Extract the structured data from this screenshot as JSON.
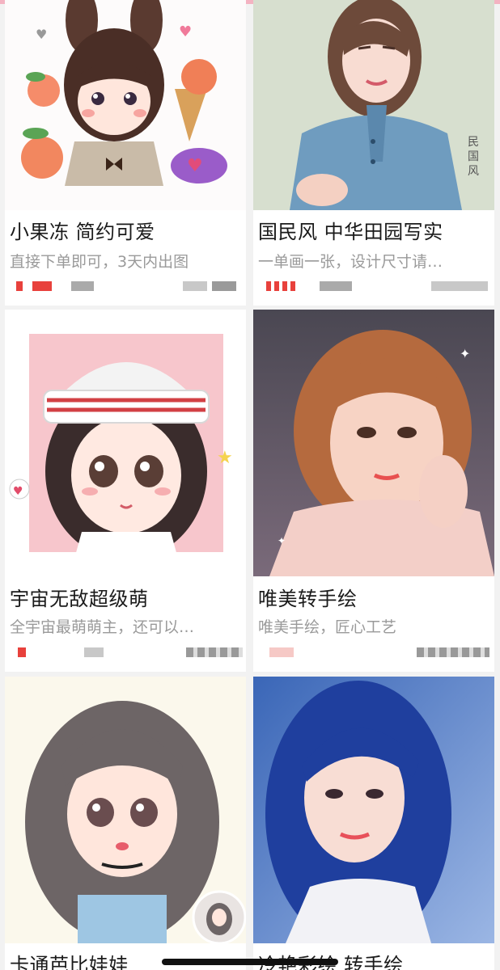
{
  "products": [
    {
      "title": "小果冻 简约可爱",
      "desc": "直接下单即可，3天内出图",
      "art": "cartoon-bunny-girl"
    },
    {
      "title": "国民风 中华田园写实",
      "desc": "一单画一张，设计尺寸请…",
      "art": "republic-style-portrait"
    },
    {
      "title": "宇宙无敌超级萌",
      "desc": "全宇宙最萌萌主，还可以…",
      "art": "cartoon-beanie-girl"
    },
    {
      "title": "唯美转手绘",
      "desc": "唯美手绘，匠心工艺",
      "art": "painted-bob-hair-portrait"
    },
    {
      "title": "卡通芭比娃娃",
      "desc": "",
      "art": "cartoon-curly-hair-girl"
    },
    {
      "title": "冷艳彩绘 转手绘",
      "desc": "",
      "art": "painted-blue-hair-portrait"
    }
  ],
  "colors": {
    "accent": "#e8413c",
    "topbar": "#f4b3c2",
    "title": "#1a1a1a",
    "desc": "#9a9a9a"
  }
}
